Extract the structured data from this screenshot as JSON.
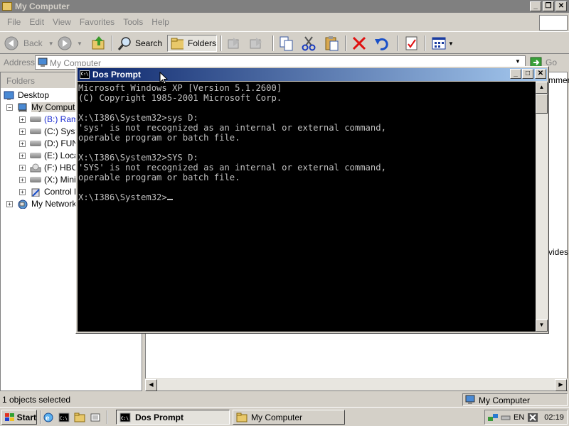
{
  "explorer": {
    "title": "My Computer",
    "menu": [
      "File",
      "Edit",
      "View",
      "Favorites",
      "Tools",
      "Help"
    ],
    "toolbar": {
      "back_label": "Back",
      "search_label": "Search",
      "folders_label": "Folders"
    },
    "address": {
      "label": "Address",
      "value": "My Computer",
      "go_label": "Go"
    },
    "folders_header": "Folders",
    "tree": [
      {
        "label": "Desktop",
        "icon": "desktop-icon"
      },
      {
        "label": "My Compute",
        "icon": "computer-icon"
      },
      {
        "label": "(B:) Ram",
        "icon": "drive-icon"
      },
      {
        "label": "(C:) Syst",
        "icon": "drive-icon"
      },
      {
        "label": "(D:) FUN",
        "icon": "drive-icon"
      },
      {
        "label": "(E:) Loca",
        "icon": "drive-icon"
      },
      {
        "label": "(F:) HBC",
        "icon": "cd-drive-icon"
      },
      {
        "label": "(X:) Mini",
        "icon": "drive-icon"
      },
      {
        "label": "Control P",
        "icon": "control-panel-icon"
      },
      {
        "label": "My Network",
        "icon": "network-icon"
      }
    ],
    "right_pane_fragments": {
      "top": "mment",
      "middle": "vides"
    },
    "status": {
      "left": "1 objects selected",
      "right": "My Computer"
    }
  },
  "dos": {
    "title": "Dos Prompt",
    "lines": [
      "Microsoft Windows XP [Version 5.1.2600]",
      "(C) Copyright 1985-2001 Microsoft Corp.",
      "",
      "X:\\I386\\System32>sys D:",
      "'sys' is not recognized as an internal or external command,",
      "operable program or batch file.",
      "",
      "X:\\I386\\System32>SYS D:",
      "'SYS' is not recognized as an internal or external command,",
      "operable program or batch file.",
      "",
      "X:\\I386\\System32>"
    ]
  },
  "taskbar": {
    "start_label": "Start",
    "tasks": [
      {
        "label": "Dos Prompt",
        "active": true
      },
      {
        "label": "My Computer",
        "active": false
      }
    ],
    "tray": {
      "language": "EN",
      "time": "02:19"
    }
  }
}
